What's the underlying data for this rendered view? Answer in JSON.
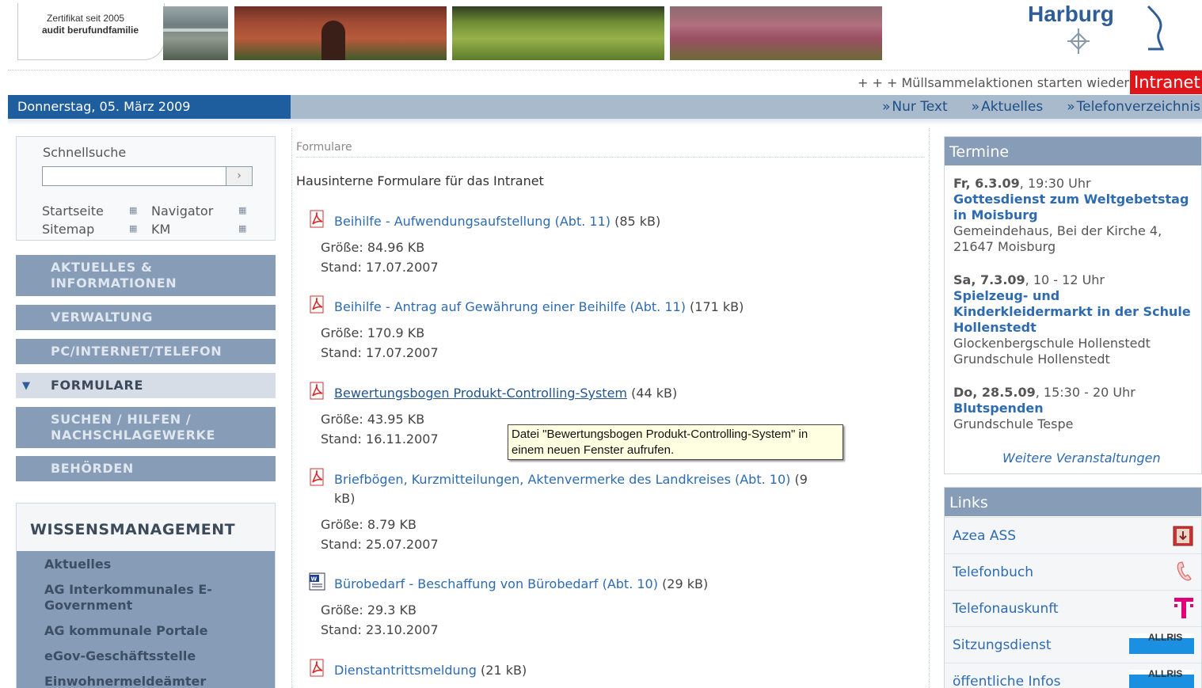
{
  "header": {
    "cert_line1": "Zertifikat seit 2005",
    "cert_line2": "audit berufundfamilie",
    "logo_text": "Harburg"
  },
  "ticker": {
    "text": "+ + +   Müllsammelaktionen starten wieder",
    "intranet_label": "Intranet"
  },
  "datebar": {
    "date": "Donnerstag, 05. März 2009",
    "nav": [
      "Nur Text",
      "Aktuelles",
      "Telefonverzeichnis"
    ]
  },
  "quicksearch": {
    "title": "Schnellsuche",
    "input_value": "",
    "go_label": "›",
    "links": [
      "Startseite",
      "Navigator",
      "Sitemap",
      "KM"
    ]
  },
  "menu": [
    {
      "line1": "AKTUELLES &",
      "line2": "INFORMATIONEN"
    },
    {
      "line1": "VERWALTUNG",
      "line2": ""
    },
    {
      "line1": "PC/INTERNET/TELEFON",
      "line2": ""
    },
    {
      "line1": "FORMULARE",
      "line2": ""
    },
    {
      "line1": "SUCHEN / HILFEN /",
      "line2": "NACHSCHLAGEWERKE"
    },
    {
      "line1": "BEHÖRDEN",
      "line2": ""
    }
  ],
  "wissensmanagement": {
    "title": "WISSENSMANAGEMENT",
    "items": [
      "Aktuelles",
      "AG Interkommunales E-Government",
      "AG kommunale Portale",
      "eGov-Geschäftsstelle",
      "Einwohnermeldeämter"
    ]
  },
  "main": {
    "breadcrumb": "Formulare",
    "intro": "Hausinterne Formulare für das Intranet",
    "docs": [
      {
        "icon": "pdf-icon",
        "title": "Beihilfe - Aufwendungsaufstellung (Abt. 11)",
        "size": "(85 kB)",
        "groesse": "Größe: 84.96 KB",
        "stand": "Stand: 17.07.2007"
      },
      {
        "icon": "pdf-icon",
        "title": "Beihilfe - Antrag auf Gewährung einer Beihilfe (Abt. 11)",
        "size": "(171 kB)",
        "groesse": "Größe: 170.9 KB",
        "stand": "Stand: 17.07.2007"
      },
      {
        "icon": "pdf-icon",
        "title": "Bewertungsbogen Produkt-Controlling-System",
        "size": "(44 kB)",
        "groesse": "Größe: 43.95 KB",
        "stand": "Stand: 16.11.2007"
      },
      {
        "icon": "pdf-icon",
        "title": "Briefbögen, Kurzmitteilungen, Aktenvermerke des Landkreises (Abt. 10)",
        "size": "(9 kB)",
        "groesse": "Größe: 8.79 KB",
        "stand": "Stand: 25.07.2007"
      },
      {
        "icon": "word-icon",
        "title": "Bürobedarf - Beschaffung von Bürobedarf (Abt. 10)",
        "size": "(29 kB)",
        "groesse": "Größe: 29.3 KB",
        "stand": "Stand: 23.10.2007"
      },
      {
        "icon": "pdf-icon",
        "title": "Dienstantrittsmeldung",
        "size": "(21 kB)",
        "groesse": "",
        "stand": ""
      }
    ],
    "tooltip": "Datei \"Bewertungsbogen Produkt-Controlling-System\" in einem neuen Fenster aufrufen."
  },
  "termine": {
    "title": "Termine",
    "events": [
      {
        "date": "Fr, 6.3.09",
        "time": ", 19:30 Uhr",
        "title": "Gottesdienst zum Weltgebetstag in Moisburg",
        "place": "Gemeindehaus, Bei der Kirche 4, 21647 Moisburg"
      },
      {
        "date": "Sa, 7.3.09",
        "time": ", 10 - 12 Uhr",
        "title": "Spielzeug- und Kinderkleidermarkt in der Schule Hollenstedt",
        "place": "Glockenbergschule Hollenstedt Grundschule Hollenstedt"
      },
      {
        "date": "Do, 28.5.09",
        "time": ", 15:30 - 20 Uhr",
        "title": "Blutspenden",
        "place": "Grundschule Tespe"
      }
    ],
    "more": "Weitere Veranstaltungen"
  },
  "links": {
    "title": "Links",
    "items": [
      {
        "label": "Azea ASS",
        "icon": "azea-icon"
      },
      {
        "label": "Telefonbuch",
        "icon": "phone-icon"
      },
      {
        "label": "Telefonauskunft",
        "icon": "telekom-icon"
      },
      {
        "label": "Sitzungsdienst",
        "icon": "allris-icon"
      },
      {
        "label": "öffentliche Infos",
        "icon": "allris-icon"
      }
    ],
    "allris_text": "ALLRIS"
  },
  "colors": {
    "link": "#2e6bb0",
    "menu_bg": "#869cb7",
    "date_bg": "#1e5e9e",
    "intranet_bg": "#e0161b"
  }
}
